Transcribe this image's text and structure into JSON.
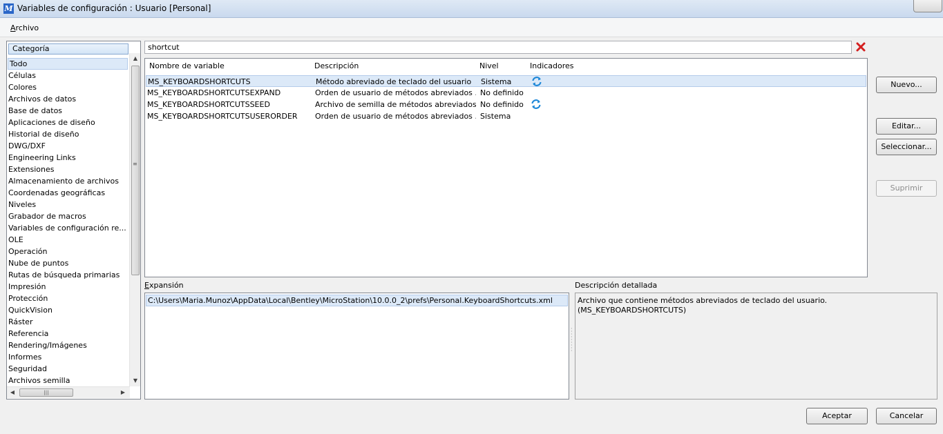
{
  "window": {
    "title": "Variables de configuración : Usuario [Personal]"
  },
  "menu": {
    "archivo_first": "A",
    "archivo_rest": "rchivo"
  },
  "category_panel": {
    "header": "Categoría",
    "items": [
      "Todo",
      "Células",
      "Colores",
      "Archivos de datos",
      "Base de datos",
      "Aplicaciones de diseño",
      "Historial de diseño",
      "DWG/DXF",
      "Engineering Links",
      "Extensiones",
      "Almacenamiento de archivos",
      "Coordenadas geográficas",
      "Niveles",
      "Grabador de macros",
      "Variables de configuración re...",
      "OLE",
      "Operación",
      "Nube de puntos",
      "Rutas de búsqueda primarias",
      "Impresión",
      "Protección",
      "QuickVision",
      "Ráster",
      "Referencia",
      "Rendering/Imágenes",
      "Informes",
      "Seguridad",
      "Archivos semilla"
    ],
    "selected_index": 0
  },
  "search": {
    "value": "shortcut"
  },
  "table": {
    "headers": {
      "name": "Nombre de variable",
      "description": "Descripción",
      "level": "Nivel",
      "flags": "Indicadores"
    },
    "rows": [
      {
        "name": "MS_KEYBOARDSHORTCUTS",
        "description": "Método abreviado de teclado del usuario",
        "level": "Sistema",
        "flag": "refresh-icon"
      },
      {
        "name": "MS_KEYBOARDSHORTCUTSEXPAND",
        "description": "Orden de usuario de métodos abreviados ...",
        "level": "No definido",
        "flag": ""
      },
      {
        "name": "MS_KEYBOARDSHORTCUTSSEED",
        "description": "Archivo de semilla de métodos abreviados...",
        "level": "No definido",
        "flag": "refresh-icon"
      },
      {
        "name": "MS_KEYBOARDSHORTCUTSUSERORDER",
        "description": "Orden de usuario de métodos abreviados ...",
        "level": "Sistema",
        "flag": ""
      }
    ],
    "selected_index": 0
  },
  "expansion": {
    "label": "Expansión",
    "value": "C:\\Users\\Maria.Munoz\\AppData\\Local\\Bentley\\MicroStation\\10.0.0_2\\prefs\\Personal.KeyboardShortcuts.xml"
  },
  "detailed_description": {
    "label": "Descripción detallada",
    "line1": "Archivo que contiene métodos abreviados de teclado del usuario.",
    "line2": "(MS_KEYBOARDSHORTCUTS)"
  },
  "buttons": {
    "new": "Nuevo...",
    "edit": "Editar...",
    "select": "Seleccionar...",
    "delete": "Suprimir",
    "accept": "Aceptar",
    "cancel": "Cancelar"
  },
  "colors": {
    "selection": "#dce9f8",
    "flag_icon": "#1e88d8",
    "clear_icon": "#d42020"
  }
}
